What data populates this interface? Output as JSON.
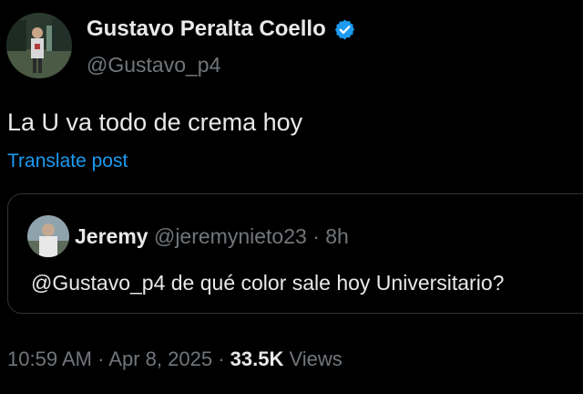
{
  "author": {
    "name": "Gustavo Peralta Coello",
    "handle": "@Gustavo_p4",
    "verified_icon": "verified-badge-icon"
  },
  "post": {
    "text": "La U va todo de crema hoy",
    "translate_label": "Translate post"
  },
  "quoted_post": {
    "name": "Jeremy",
    "handle": "@jeremynieto23",
    "separator": "·",
    "time": "8h",
    "text": "@Gustavo_p4 de qué color sale hoy Universitario?"
  },
  "meta": {
    "time": "10:59 AM",
    "sep1": "·",
    "date": "Apr 8, 2025",
    "sep2": "·",
    "views_count": "33.5K",
    "views_label": "Views"
  },
  "colors": {
    "background": "#000000",
    "text_primary": "#e7e9ea",
    "text_secondary": "#71767b",
    "link": "#1d9bf0",
    "border": "#2f3336"
  }
}
